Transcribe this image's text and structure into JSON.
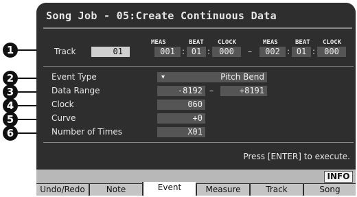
{
  "screen": {
    "title": "Song Job - 05:Create Continuous Data",
    "track": {
      "label": "Track",
      "value": "01"
    },
    "range_headers": {
      "meas": "MEAS",
      "beat": "BEAT",
      "clock": "CLOCK"
    },
    "range_start": {
      "meas": "001",
      "beat": "01",
      "clock": "000"
    },
    "range_dash": "–",
    "range_end": {
      "meas": "002",
      "beat": "01",
      "clock": "000"
    },
    "event_type": {
      "label": "Event Type",
      "arrow": "▾",
      "value": "Pitch Bend"
    },
    "data_range": {
      "label": "Data Range",
      "low": "-8192",
      "dash": "–",
      "high": "+8191"
    },
    "clock": {
      "label": "Clock",
      "value": "060"
    },
    "curve": {
      "label": "Curve",
      "value": "+0"
    },
    "number_of_times": {
      "label": "Number of Times",
      "value": "X01"
    },
    "press_text": "Press [ENTER] to execute.",
    "info_button": "INFO"
  },
  "tabs": [
    {
      "label": "Undo/Redo"
    },
    {
      "label": "Note"
    },
    {
      "label": "Event"
    },
    {
      "label": "Measure"
    },
    {
      "label": "Track"
    },
    {
      "label": "Song"
    }
  ],
  "active_tab": "Event",
  "callouts": [
    "1",
    "2",
    "3",
    "4",
    "5",
    "6"
  ]
}
